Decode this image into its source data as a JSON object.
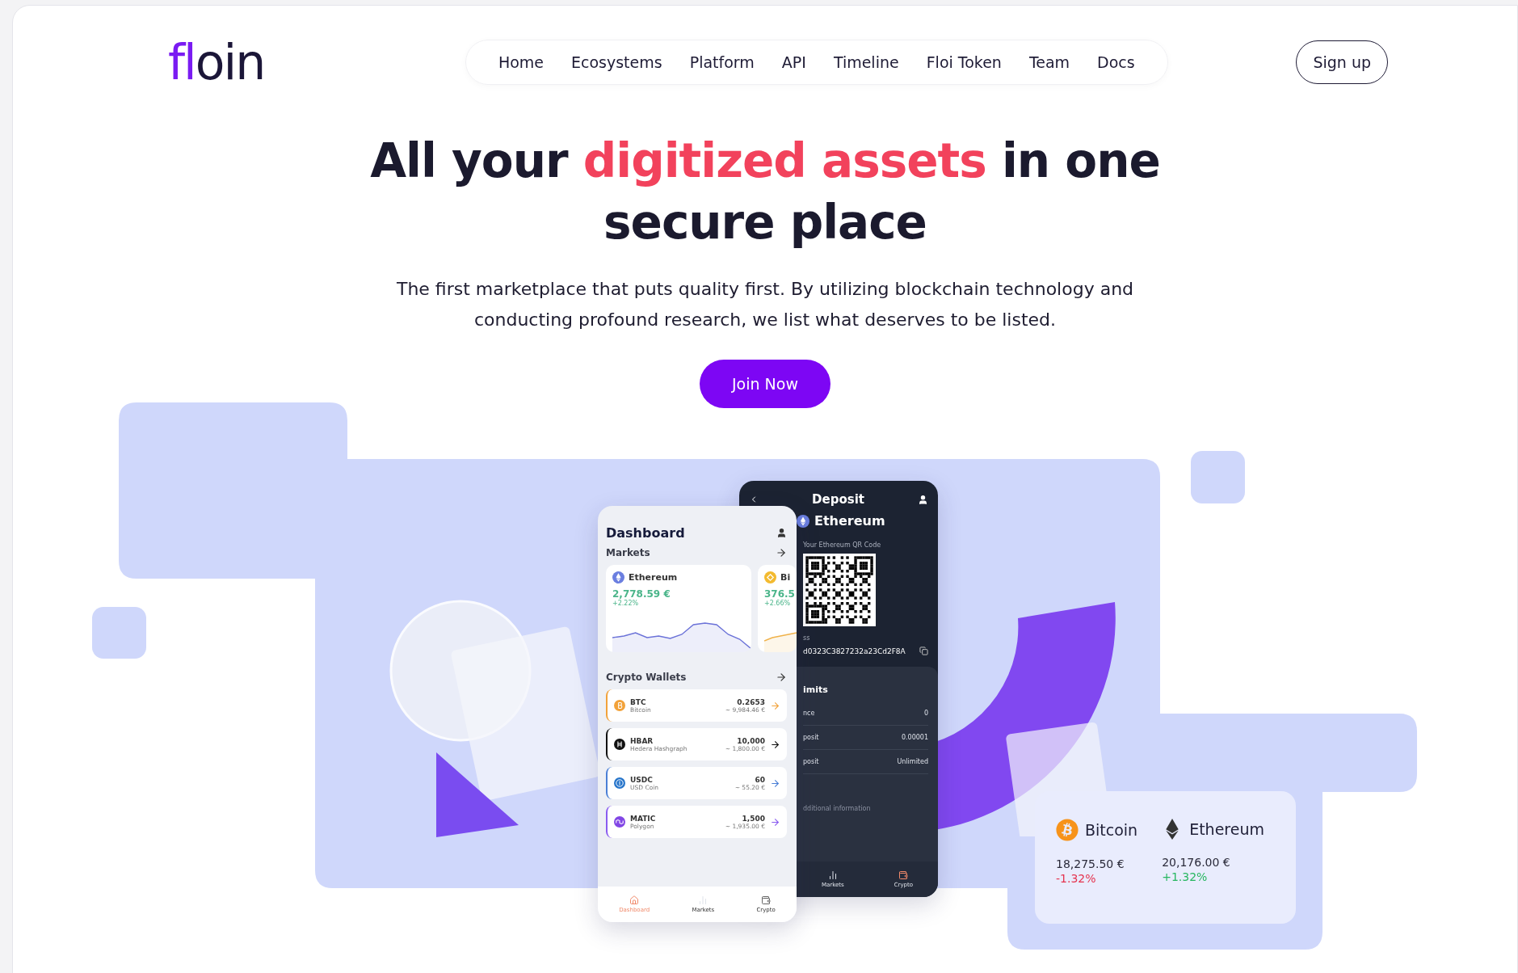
{
  "logo": {
    "accent": "fl",
    "rest": "oin"
  },
  "nav": [
    {
      "label": "Home"
    },
    {
      "label": "Ecosystems"
    },
    {
      "label": "Platform"
    },
    {
      "label": "API"
    },
    {
      "label": "Timeline"
    },
    {
      "label": "Floi Token"
    },
    {
      "label": "Team"
    },
    {
      "label": "Docs"
    }
  ],
  "signup": "Sign up",
  "hero": {
    "title_parts": [
      {
        "text": "All your ",
        "highlight": false
      },
      {
        "text": "digitized assets",
        "highlight": true
      },
      {
        "text": " in one secure place",
        "highlight": false
      }
    ],
    "subtitle": "The first marketplace that puts quality first. By utilizing blockchain technology and conducting profound research, we list what deserves to be listed.",
    "cta": "Join Now"
  },
  "dashboard": {
    "title": "Dashboard",
    "markets_label": "Markets",
    "markets": [
      {
        "kind": "eth",
        "name": "Ethereum",
        "price": "2,778.59 €",
        "change": "+2.22%",
        "color": "#6b72d8"
      },
      {
        "kind": "bnb",
        "name": "Bi",
        "price": "376.5",
        "change": "+2.66%",
        "color": "#f0b24a"
      }
    ],
    "wallets_label": "Crypto Wallets",
    "wallets": [
      {
        "kind": "btc",
        "symbol": "BTC",
        "name": "Bitcoin",
        "amount": "0.2653",
        "value": "~ 9,984.46 €",
        "color": "#f2a23a"
      },
      {
        "kind": "hbar",
        "symbol": "HBAR",
        "name": "Hedera Hashgraph",
        "amount": "10,000",
        "value": "~ 1,800.00 €",
        "color": "#111111"
      },
      {
        "kind": "usdc",
        "symbol": "USDC",
        "name": "USD Coin",
        "amount": "60",
        "value": "~ 55.20 €",
        "color": "#4a7fd6"
      },
      {
        "kind": "matic",
        "symbol": "MATIC",
        "name": "Polygon",
        "amount": "1,500",
        "value": "~ 1,935.00 €",
        "color": "#8a5cf0"
      }
    ],
    "nav": [
      {
        "kind": "home",
        "label": "Dashboard",
        "selected": true
      },
      {
        "kind": "chart",
        "label": "Markets",
        "selected": false
      },
      {
        "kind": "wallet",
        "label": "Crypto",
        "selected": false
      }
    ]
  },
  "deposit": {
    "title": "Deposit",
    "coin": "Ethereum",
    "qr_label": "Your Ethereum QR Code",
    "address_label": "ss",
    "address": "d0323C3827232a23Cd2F8A",
    "limits_title": "imits",
    "limits": [
      {
        "label": "nce",
        "value": "0"
      },
      {
        "label": "posit",
        "value": "0.00001"
      },
      {
        "label": "posit",
        "value": "Unlimited"
      }
    ],
    "more": "dditional information",
    "nav": [
      {
        "kind": "chart",
        "label": "Markets",
        "selected": false
      },
      {
        "kind": "wallet",
        "label": "Crypto",
        "selected": true
      }
    ]
  },
  "price_card": {
    "coins": [
      {
        "kind": "btc",
        "name": "Bitcoin",
        "price": "18,275.50 €",
        "change": "-1.32%",
        "color": "#e5334f"
      },
      {
        "kind": "eth",
        "name": "Ethereum",
        "price": "20,176.00 €",
        "change": "+1.32%",
        "color": "#27b760"
      }
    ]
  }
}
